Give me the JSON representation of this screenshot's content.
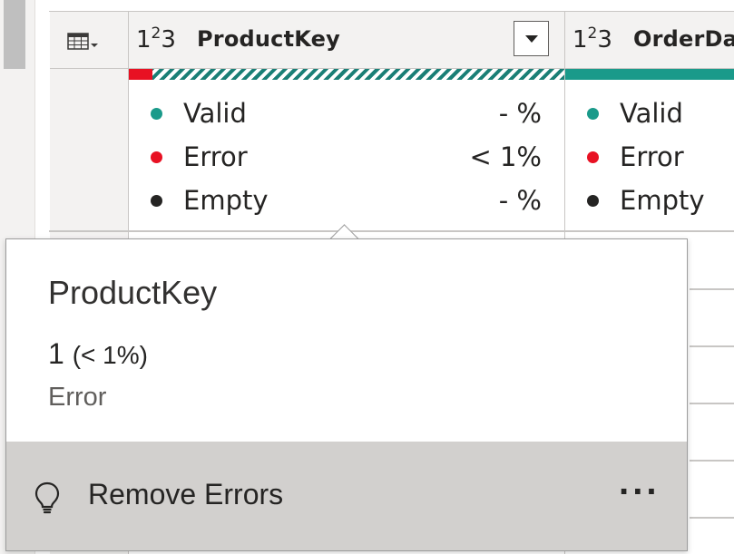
{
  "columns": [
    {
      "type_icon": "1²3",
      "type_main": "1",
      "type_sup": "2",
      "type_end": "3",
      "title": "ProductKey",
      "quality": [
        {
          "label": "Valid",
          "pct": "- %",
          "color": "#1a9a8a"
        },
        {
          "label": "Error",
          "pct": "< 1%",
          "color": "#e81123"
        },
        {
          "label": "Empty",
          "pct": "- %",
          "color": "#252423"
        }
      ]
    },
    {
      "type_main": "1",
      "type_sup": "2",
      "type_end": "3",
      "title": "OrderDa",
      "quality": [
        {
          "label": "Valid",
          "color": "#1a9a8a"
        },
        {
          "label": "Error",
          "color": "#e81123"
        },
        {
          "label": "Empty",
          "color": "#252423"
        }
      ]
    }
  ],
  "tooltip": {
    "title": "ProductKey",
    "count": "1",
    "count_pct": "(< 1%)",
    "kind": "Error",
    "action_label": "Remove Errors",
    "more_label": "···",
    "action_icon": "lightbulb-icon"
  },
  "icons": {
    "corner": "table-icon",
    "dropdown": "chevron-down-icon"
  }
}
